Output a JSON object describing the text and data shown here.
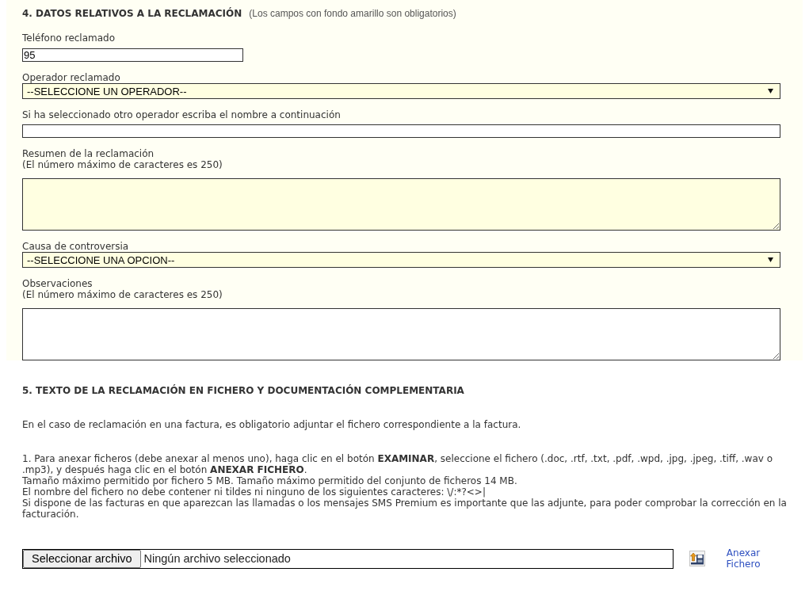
{
  "section_4": {
    "title": "4. DATOS RELATIVOS A LA RECLAMACIÓN",
    "note": "(Los campos con fondo amarillo son obligatorios)",
    "fields": [
      {
        "kind": "phone",
        "label": "Teléfono reclamado",
        "value": "95",
        "required": false
      },
      {
        "kind": "select",
        "label": "Operador reclamado",
        "value": "--SELECCIONE UN OPERADOR--",
        "required": true
      },
      {
        "kind": "text",
        "label": "Si ha seleccionado otro operador escriba el nombre a continuación",
        "required": false
      },
      {
        "kind": "textarea",
        "label": "Resumen de la reclamación",
        "hint": "(El número máximo de caracteres es 250)",
        "required": true
      },
      {
        "kind": "select",
        "label": "Causa de controversia",
        "value": "--SELECCIONE UNA OPCION--",
        "required": true
      },
      {
        "kind": "textarea",
        "label": "Observaciones",
        "hint": "(El número máximo de caracteres es 250)",
        "required": false
      }
    ]
  },
  "section_5": {
    "title": "5. TEXTO DE LA RECLAMACIÓN EN FICHERO Y DOCUMENTACIÓN COMPLEMENTARIA",
    "notice": "En el caso de reclamación en una factura, es obligatorio adjuntar el fichero correspondiente a la factura.",
    "instructions": [
      "1. Para anexar ficheros (debe anexar al menos uno), haga clic en el botón **EXAMINAR**, seleccione el fichero (.doc, .rtf, .txt, .pdf, .wpd, .jpg, .jpeg, .tiff, .wav o .mp3), y después haga clic en el botón **ANEXAR FICHERO**.",
      "Tamaño máximo permitido por fichero 5 MB. Tamaño máximo permitido del conjunto de ficheros 14 MB.",
      "El nombre del fichero no debe contener ni tildes ni ninguno de los siguientes caracteres: \\/:*?<>|",
      "Si dispone de las facturas en que aparezcan las llamadas o los mensajes SMS Premium es importante que las adjunte, para poder comprobar la corrección en la facturación."
    ],
    "file_input": {
      "button": "Seleccionar archivo",
      "status": "Ningún archivo seleccionado"
    },
    "attach_link": "Anexar Fichero"
  }
}
